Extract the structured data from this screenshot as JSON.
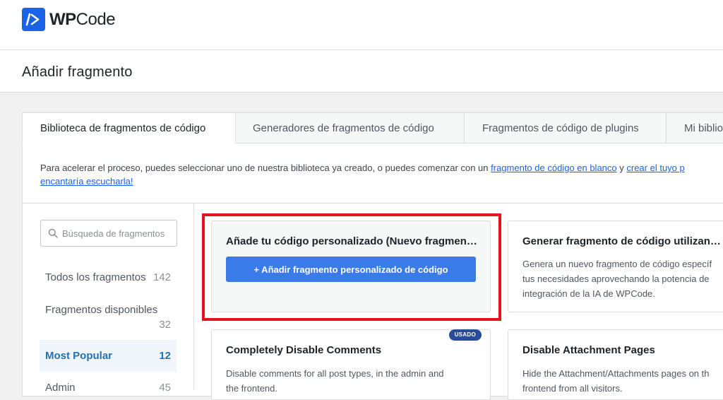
{
  "app": {
    "logo_bold": "WP",
    "logo_light": "Code",
    "logo_icon": "wpcode-slash-icon",
    "accent": "#1a63e6"
  },
  "page": {
    "title": "Añadir fragmento"
  },
  "tabs": [
    {
      "label": "Biblioteca de fragmentos de código",
      "active": true
    },
    {
      "label": "Generadores de fragmentos de código",
      "active": false
    },
    {
      "label": "Fragmentos de código de plugins",
      "active": false
    },
    {
      "label": "Mi biblioteca",
      "active": false
    }
  ],
  "intro": {
    "text_before": "Para acelerar el proceso, puedes seleccionar uno de nuestra biblioteca ya creado, o puedes comenzar con un ",
    "link_blank": "fragmento de código en blanco",
    "text_middle": " y ",
    "link_create": "crear el tuyo p",
    "line2_link": "encantaría escucharla!"
  },
  "search": {
    "placeholder": "Búsqueda de fragmentos",
    "icon": "search-icon"
  },
  "categories": [
    {
      "label": "Todos los fragmentos",
      "count": "142",
      "active": false
    },
    {
      "label": "Fragmentos disponibles",
      "count": "32",
      "active": false
    },
    {
      "label": "Most Popular",
      "count": "12",
      "active": true
    },
    {
      "label": "Admin",
      "count": "45",
      "active": false
    }
  ],
  "cards": {
    "custom": {
      "title": "Añade tu código personalizado (Nuevo fragmento)",
      "button": "+ Añadir fragmento personalizado de código"
    },
    "ai": {
      "title": "Generar fragmento de código utilizando IA",
      "desc1": "Genera un nuevo fragmento de código específ",
      "desc2": "tus necesidades aprovechando la potencia de",
      "desc3": "integración de la IA de WPCode."
    },
    "comments": {
      "title": "Completely Disable Comments",
      "badge": "USADO",
      "desc1": "Disable comments for all post types, in the admin and",
      "desc2": "the frontend."
    },
    "attachment": {
      "title": "Disable Attachment Pages",
      "desc1": "Hide the Attachment/Attachments pages on th",
      "desc2": "frontend from all visitors."
    }
  },
  "colors": {
    "primary_button": "#3a7bea",
    "highlight_border": "#e3121b",
    "badge": "#2a4b9b",
    "active_category": "#2271b1"
  }
}
